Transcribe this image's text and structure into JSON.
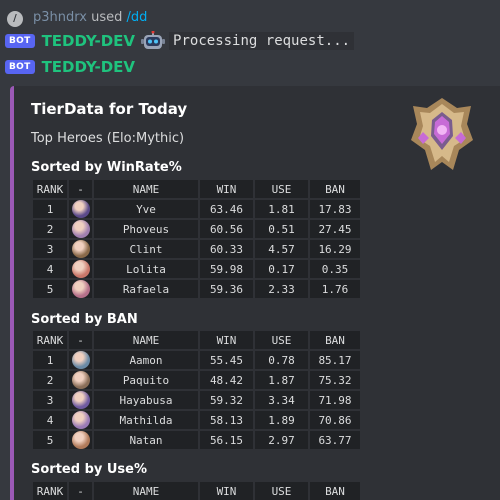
{
  "reply": {
    "slash_icon": "/",
    "username": "p3hndrx",
    "used_text": "used",
    "command": "/dd"
  },
  "bot1": {
    "badge": "BOT",
    "name": "TEDDY-DEV",
    "icon": "robot-icon",
    "processing_text": "Processing request..."
  },
  "bot2": {
    "badge": "BOT",
    "name": "TEDDY-DEV"
  },
  "embed": {
    "accent_color": "#9b59b6",
    "title": "TierData for Today",
    "description": "Top Heroes (Elo:Mythic)",
    "thumbnail": "mythic-rank-emblem"
  },
  "columns": [
    "RANK",
    "-",
    "NAME",
    "WIN",
    "USE",
    "BAN"
  ],
  "sections": [
    {
      "title": "Sorted by WinRate%",
      "rows": [
        {
          "rank": "1",
          "avatar": "#5b4a8a",
          "name": "Yve",
          "win": "63.46",
          "use": "1.81",
          "ban": "17.83"
        },
        {
          "rank": "2",
          "avatar": "#a07fb0",
          "name": "Phoveus",
          "win": "60.56",
          "use": "0.51",
          "ban": "27.45"
        },
        {
          "rank": "3",
          "avatar": "#8a6a4a",
          "name": "Clint",
          "win": "60.33",
          "use": "4.57",
          "ban": "16.29"
        },
        {
          "rank": "4",
          "avatar": "#c9776a",
          "name": "Lolita",
          "win": "59.98",
          "use": "0.17",
          "ban": "0.35"
        },
        {
          "rank": "5",
          "avatar": "#b5708a",
          "name": "Rafaela",
          "win": "59.36",
          "use": "2.33",
          "ban": "1.76"
        }
      ]
    },
    {
      "title": "Sorted by BAN",
      "rows": [
        {
          "rank": "1",
          "avatar": "#6a8aa6",
          "name": "Aamon",
          "win": "55.45",
          "use": "0.78",
          "ban": "85.17"
        },
        {
          "rank": "2",
          "avatar": "#8a6e58",
          "name": "Paquito",
          "win": "48.42",
          "use": "1.87",
          "ban": "75.32"
        },
        {
          "rank": "3",
          "avatar": "#6f5aa0",
          "name": "Hayabusa",
          "win": "59.32",
          "use": "3.34",
          "ban": "71.98"
        },
        {
          "rank": "4",
          "avatar": "#9a7ab5",
          "name": "Mathilda",
          "win": "58.13",
          "use": "1.89",
          "ban": "70.86"
        },
        {
          "rank": "5",
          "avatar": "#b07a5a",
          "name": "Natan",
          "win": "56.15",
          "use": "2.97",
          "ban": "63.77"
        }
      ]
    },
    {
      "title": "Sorted by Use%",
      "rows": []
    }
  ]
}
